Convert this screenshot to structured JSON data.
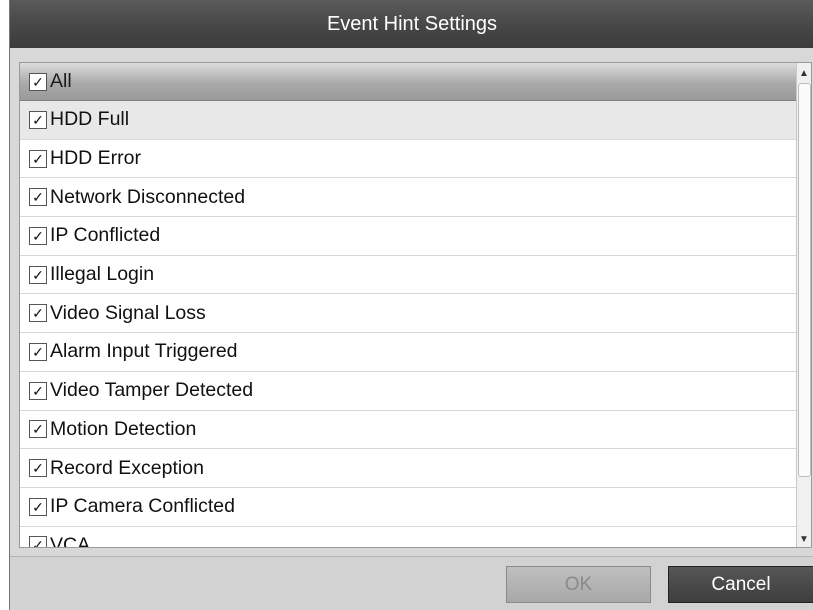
{
  "window": {
    "title": "Event Hint Settings"
  },
  "list": {
    "header": {
      "label": "All",
      "checked": true
    },
    "items": [
      {
        "label": "HDD Full",
        "checked": true
      },
      {
        "label": "HDD Error",
        "checked": true
      },
      {
        "label": "Network Disconnected",
        "checked": true
      },
      {
        "label": "IP Conflicted",
        "checked": true
      },
      {
        "label": "Illegal Login",
        "checked": true
      },
      {
        "label": "Video Signal Loss",
        "checked": true
      },
      {
        "label": "Alarm Input Triggered",
        "checked": true
      },
      {
        "label": "Video Tamper Detected",
        "checked": true
      },
      {
        "label": "Motion Detection",
        "checked": true
      },
      {
        "label": "Record Exception",
        "checked": true
      },
      {
        "label": "IP Camera Conflicted",
        "checked": true
      },
      {
        "label": "VCA",
        "checked": true
      }
    ]
  },
  "buttons": {
    "ok": "OK",
    "cancel": "Cancel"
  }
}
